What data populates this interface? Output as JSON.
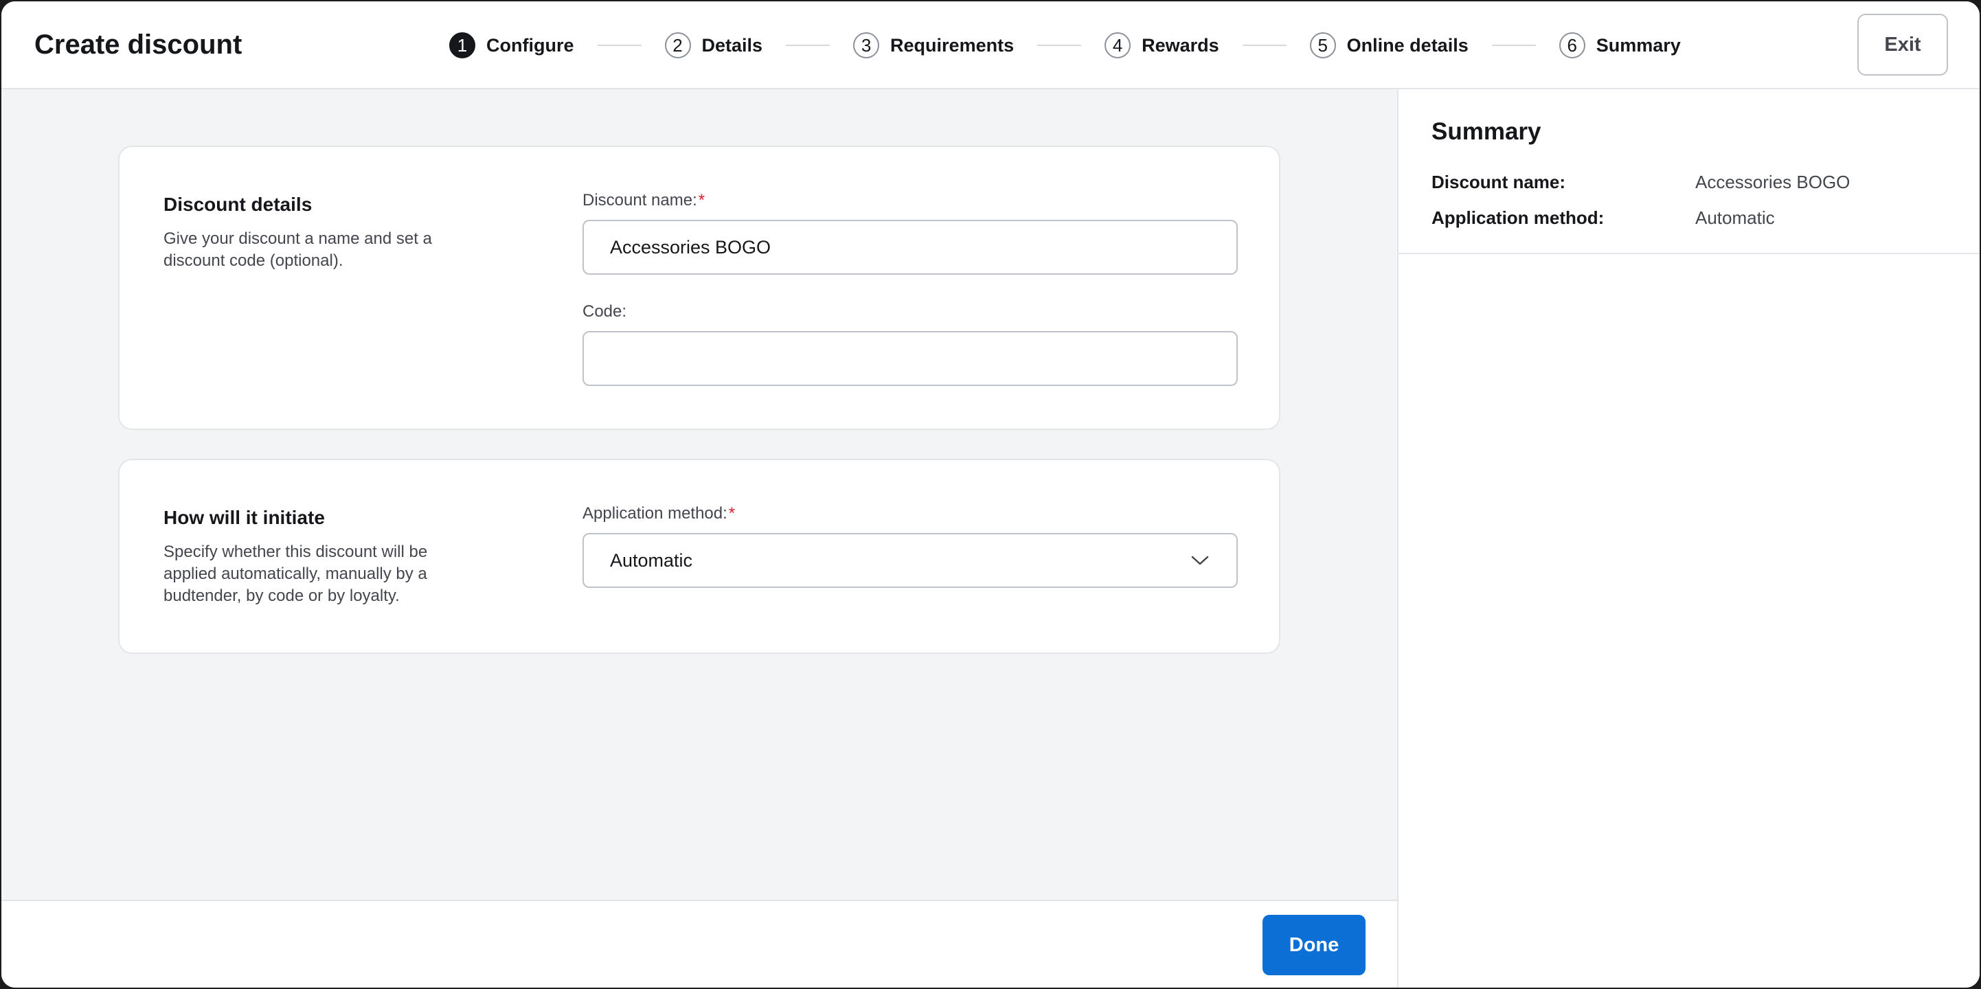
{
  "header": {
    "title": "Create discount",
    "exit_label": "Exit",
    "steps": [
      {
        "num": "1",
        "label": "Configure"
      },
      {
        "num": "2",
        "label": "Details"
      },
      {
        "num": "3",
        "label": "Requirements"
      },
      {
        "num": "4",
        "label": "Rewards"
      },
      {
        "num": "5",
        "label": "Online details"
      },
      {
        "num": "6",
        "label": "Summary"
      }
    ]
  },
  "discount_details": {
    "heading": "Discount details",
    "description": "Give your discount a name and set a discount code (optional).",
    "name_label": "Discount name:",
    "required_mark": "*",
    "name_value": "Accessories BOGO",
    "code_label": "Code:",
    "code_value": ""
  },
  "initiate": {
    "heading": "How will it initiate",
    "description": "Specify whether this discount will be applied automatically, manually by a budtender, by code or by loyalty.",
    "method_label": "Application method:",
    "required_mark": "*",
    "method_value": "Automatic"
  },
  "footer": {
    "done_label": "Done"
  },
  "summary": {
    "title": "Summary",
    "rows": [
      {
        "key": "Discount name:",
        "value": "Accessories BOGO"
      },
      {
        "key": "Application method:",
        "value": "Automatic"
      }
    ]
  },
  "colors": {
    "primary": "#0b6fd6",
    "required": "#d61f2c",
    "background": "#f3f4f6"
  }
}
